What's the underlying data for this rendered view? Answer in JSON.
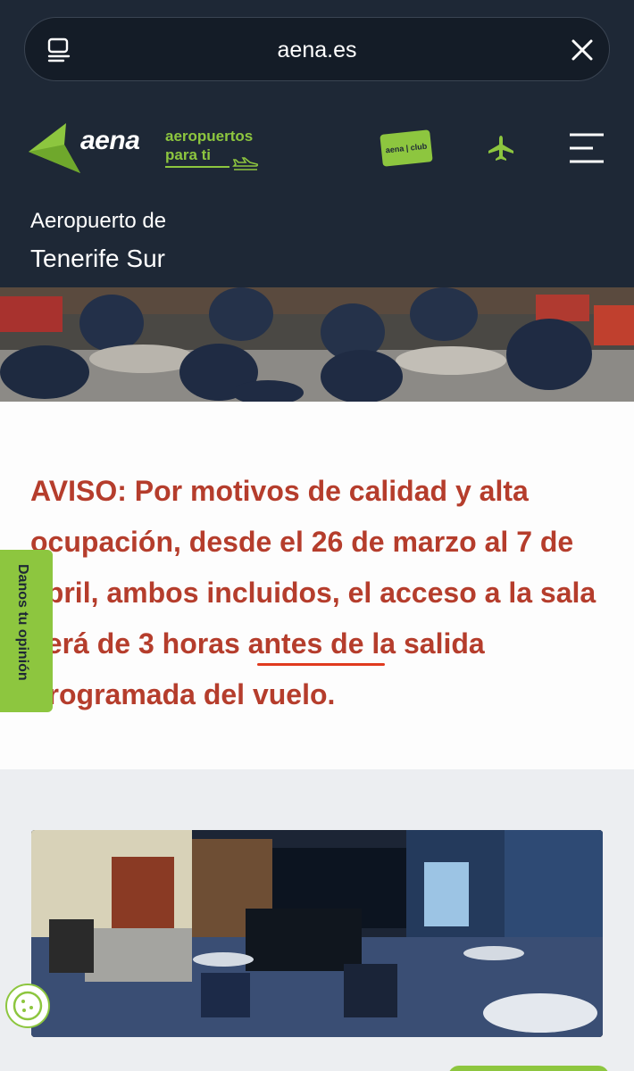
{
  "browser": {
    "url": "aena.es",
    "reader_icon": "reader-icon",
    "close_icon": "close-icon"
  },
  "header": {
    "logo_text": "aena",
    "tagline_line1": "aeropuertos",
    "tagline_line2": "para ti",
    "club_badge": "aena | club",
    "plane_icon": "airplane-icon",
    "menu_icon": "hamburger-menu-icon",
    "airport_prefix": "Aeropuerto de",
    "airport_name": "Tenerife Sur"
  },
  "notice": {
    "text": "AVISO: Por motivos de calidad y alta ocupación, desde el 26 de marzo al 7 de abril, ambos incluidos, el acceso a la sala será de 3 horas antes de la salida programada del vuelo."
  },
  "feedback": {
    "label": "Danos tu opinión"
  },
  "colors": {
    "brand_green": "#8dc63f",
    "header_navy": "#1e2836",
    "notice_red": "#b53d2c",
    "underline_red": "#e03a1e"
  }
}
